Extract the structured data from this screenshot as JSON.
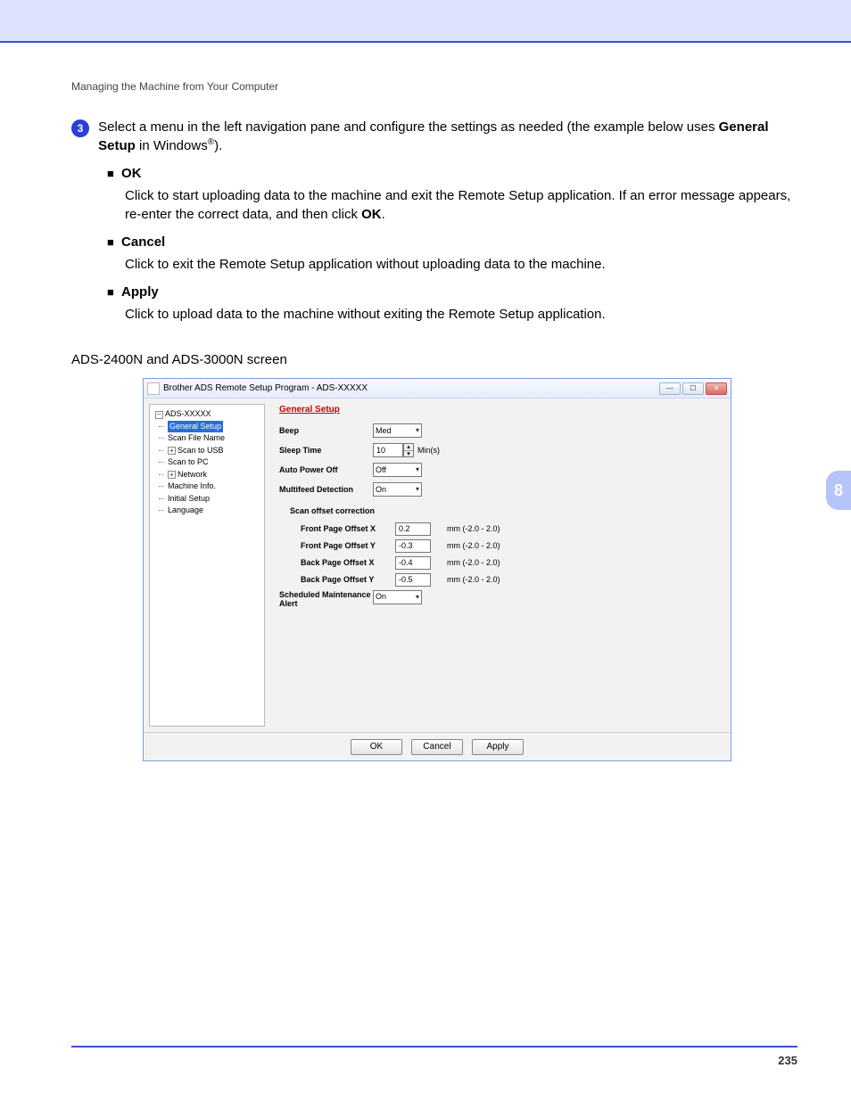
{
  "breadcrumb": "Managing the Machine from Your Computer",
  "step": {
    "num": "3",
    "text_a": "Select a menu in the left navigation pane and configure the settings as needed (the example below uses ",
    "bold": "General Setup",
    "text_b": " in Windows",
    "sup": "®",
    "text_c": ")."
  },
  "items": [
    {
      "label": "OK",
      "desc_a": "Click to start uploading data to the machine and exit the Remote Setup application. If an error message appears, re-enter the correct data, and then click ",
      "desc_bold": "OK",
      "desc_b": "."
    },
    {
      "label": "Cancel",
      "desc_a": "Click to exit the Remote Setup application without uploading data to the machine.",
      "desc_bold": "",
      "desc_b": ""
    },
    {
      "label": "Apply",
      "desc_a": "Click to upload data to the machine without exiting the Remote Setup application.",
      "desc_bold": "",
      "desc_b": ""
    }
  ],
  "screen_label": "ADS-2400N and ADS-3000N screen",
  "window": {
    "title": "Brother ADS Remote Setup Program - ADS-XXXXX",
    "tree": {
      "root": "ADS-XXXXX",
      "items": [
        {
          "label": "General Setup",
          "selected": true,
          "expander": ""
        },
        {
          "label": "Scan File Name",
          "selected": false,
          "expander": ""
        },
        {
          "label": "Scan to USB",
          "selected": false,
          "expander": "+"
        },
        {
          "label": "Scan to PC",
          "selected": false,
          "expander": ""
        },
        {
          "label": "Network",
          "selected": false,
          "expander": "+"
        },
        {
          "label": "Machine Info.",
          "selected": false,
          "expander": ""
        },
        {
          "label": "Initial Setup",
          "selected": false,
          "expander": ""
        },
        {
          "label": "Language",
          "selected": false,
          "expander": ""
        }
      ]
    },
    "panel": {
      "title": "General Setup",
      "beep": {
        "label": "Beep",
        "value": "Med"
      },
      "sleep": {
        "label": "Sleep Time",
        "value": "10",
        "unit": "Min(s)"
      },
      "auto_off": {
        "label": "Auto Power Off",
        "value": "Off"
      },
      "multifeed": {
        "label": "Multifeed Detection",
        "value": "On"
      },
      "offset_section": "Scan offset correction",
      "offsets": [
        {
          "label": "Front Page Offset X",
          "value": "0.2",
          "range": "mm (-2.0 - 2.0)"
        },
        {
          "label": "Front Page Offset Y",
          "value": "-0.3",
          "range": "mm (-2.0 - 2.0)"
        },
        {
          "label": "Back Page Offset X",
          "value": "-0.4",
          "range": "mm (-2.0 - 2.0)"
        },
        {
          "label": "Back Page Offset Y",
          "value": "-0.5",
          "range": "mm (-2.0 - 2.0)"
        }
      ],
      "sched": {
        "label": "Scheduled Maintenance Alert",
        "value": "On"
      }
    },
    "buttons": {
      "ok": "OK",
      "cancel": "Cancel",
      "apply": "Apply"
    }
  },
  "chapter_tab": "8",
  "page_number": "235"
}
